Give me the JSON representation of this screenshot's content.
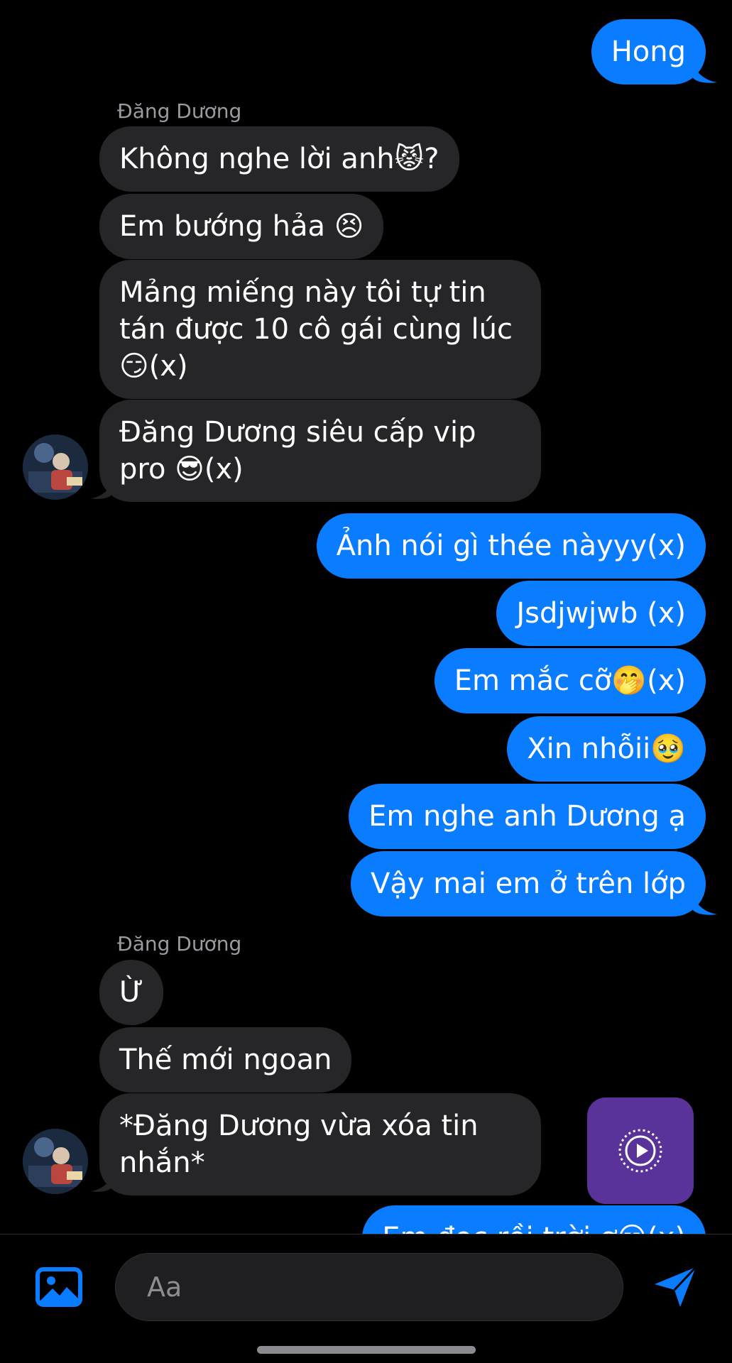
{
  "messages": {
    "m0": "Hong",
    "m1": "Không nghe lời anh😾?",
    "m2": "Em bướng hảa 😣",
    "m3": "Mảng miếng này tôi tự tin\ntán được 10 cô gái cùng lúc\n😏(x)",
    "m4": "Đăng Dương siêu cấp vip\npro 😎(x)",
    "m5": "Ảnh nói gì thée nàyyy(x)",
    "m6": "Jsdjwjwb (x)",
    "m7": "Em mắc cỡ🤭(x)",
    "m8": "Xin nhỗii🥹",
    "m9": "Em nghe anh Dương ạ",
    "m10": "Vậy mai em ở trên lớp",
    "m11": "Ừ",
    "m12": "Thế mới ngoan",
    "m13": "*Đăng Dương vừa xóa tin\nnhắn*",
    "m14": "Em đọc rồi trời ơ😑(x)"
  },
  "sender_names": {
    "first": "Đăng Dương",
    "second": "Đăng Dương"
  },
  "composer": {
    "placeholder": "Aa"
  },
  "icons": {
    "photo": "photo-icon",
    "send": "send-icon",
    "voice": "play-circle-icon"
  },
  "colors": {
    "outgoing_bubble": "#0a7cff",
    "incoming_bubble": "#262628",
    "background": "#000000",
    "voice_button": "#59339a"
  }
}
